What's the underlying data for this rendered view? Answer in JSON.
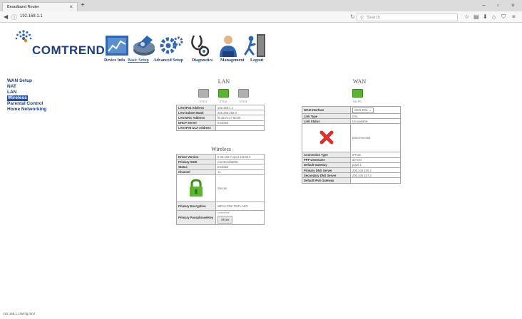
{
  "browser": {
    "tab_title": "Broadband Router",
    "tab_close": "×",
    "new_tab": "+",
    "win_min": "−",
    "win_max": "▫",
    "win_close": "×",
    "back": "◀",
    "info": "ⓘ",
    "url": "192.168.1.1",
    "reload": "↻",
    "search_icon": "⚲",
    "search_placeholder": "Search",
    "toolbar_icons": [
      "☆",
      "▤",
      "⬇",
      "⌂",
      "⛉",
      "≡"
    ]
  },
  "header": {
    "logo_text": "COMTREND",
    "menu": [
      {
        "label": "Device Info",
        "icon": "device-info-icon"
      },
      {
        "label": "Basic Setup",
        "icon": "basic-setup-icon"
      },
      {
        "label": "Advanced Setup",
        "icon": "advanced-setup-icon"
      },
      {
        "label": "Diagnostics",
        "icon": "diagnostics-icon"
      },
      {
        "label": "Management",
        "icon": "management-icon"
      },
      {
        "label": "Logout",
        "icon": "logout-icon"
      }
    ],
    "active_menu": "Basic Setup",
    "brand_color": "#1f3e7a"
  },
  "sidebar": {
    "items": [
      {
        "label": "WAN Setup"
      },
      {
        "label": "NAT"
      },
      {
        "label": "LAN"
      },
      {
        "label": "Wireless"
      },
      {
        "label": "Parental Control"
      },
      {
        "label": "Home Networking"
      }
    ],
    "active": "Wireless"
  },
  "lan": {
    "title": "LAN",
    "ports": [
      {
        "label": "ETH1",
        "status": "inactive"
      },
      {
        "label": "ETH2",
        "status": "active"
      },
      {
        "label": "ETH3",
        "status": "inactive"
      }
    ],
    "rows": [
      {
        "key": "LAN IPv4 Address",
        "value": "192.168.1.1"
      },
      {
        "key": "LAN Subnet Mask",
        "value": "255.255.255.0"
      },
      {
        "key": "LAN MAC Address",
        "value": "f8:da:0c:47:5b:50"
      },
      {
        "key": "DHCP Server",
        "value": "Enabled"
      },
      {
        "key": "LAN IPv6 ULA Address",
        "value": ""
      }
    ]
  },
  "wireless": {
    "title": "Wireless",
    "rows": [
      {
        "key": "Driver Version",
        "value": "6.30.102.7.cpe4.12L08.4"
      },
      {
        "key": "Primary SSID",
        "value": "Comtrend5D00"
      },
      {
        "key": "Status",
        "value": "Enabled"
      },
      {
        "key": "Channel",
        "value": "11"
      }
    ],
    "security_value": "Secure",
    "encryption_key": "Primary Encryption",
    "encryption_value": "WPA2-PSK TKIP+AES",
    "passphrase_key": "Primary Passphrase/Key",
    "passphrase_value": "**********",
    "show_button": "Show"
  },
  "wan": {
    "title": "WAN",
    "port_label": "GE P0",
    "interface_key": "WAN Interface",
    "interface_value": "SED DSL",
    "link_type_key": "Link Type",
    "link_type_value": "DSL",
    "link_status_key": "Link Status",
    "link_status_value": "Unavailable",
    "connection_status_value": "Disconnected",
    "rows": [
      {
        "key": "Connection Type",
        "value": "IPPoE"
      },
      {
        "key": "PPP Username",
        "value": "ab-test"
      },
      {
        "key": "Default Gateway",
        "value": "ppp0.1"
      },
      {
        "key": "Primary DNS Server",
        "value": "200.100.100.2"
      },
      {
        "key": "Secondary DNS Server",
        "value": "200.100.107.2"
      },
      {
        "key": "Default IPv6 Gateway",
        "value": ""
      }
    ]
  },
  "status_bar": "192.168.1.1/wlcfg.html"
}
